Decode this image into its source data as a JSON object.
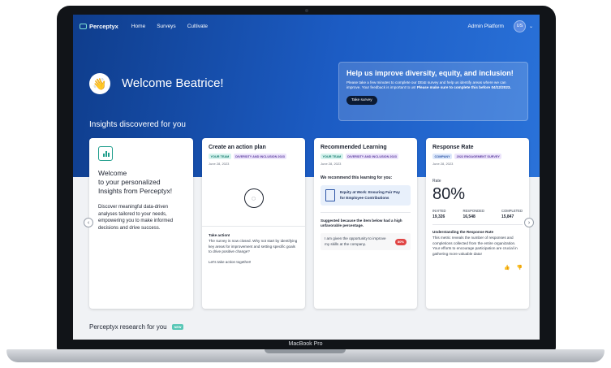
{
  "device": {
    "label": "MacBook Pro"
  },
  "nav": {
    "logo": "Perceptyx",
    "links": [
      "Home",
      "Surveys",
      "Cultivate"
    ],
    "admin": "Admin Platform",
    "user_initials": "US"
  },
  "hero": {
    "welcome": "Welcome Beatrice!",
    "insights_title": "Insights discovered for you"
  },
  "dei": {
    "title": "Help us improve diversity, equity, and inclusion!",
    "body": "Please take a few minutes to complete our DE&I survey and help us identify areas where we can improve. Your feedback is important to us!",
    "body_bold": "Please make sure to complete this before 04/12/2023.",
    "button": "Take survey"
  },
  "card_welcome": {
    "heading": "Welcome\nto your personalized\nInsights from Perceptyx!",
    "text": "Discover meaningful data-driven analyses tailored to your needs, empowering you to make informed decisions and drive success."
  },
  "card_action": {
    "title": "Create an action plan",
    "tags": [
      "YOUR TEAM",
      "DIVERSITY AND INCLUSION 2023"
    ],
    "date": "June 28, 2023",
    "heading": "Take action!",
    "text": "The survey is now closed. Why not start by identifying key areas for improvement and setting specific goals to drive positive change?",
    "cta": "Let's take action together!"
  },
  "card_learning": {
    "title": "Recommended Learning",
    "tags": [
      "YOUR TEAM",
      "DIVERSITY AND INCLUSION 2023"
    ],
    "date": "June 28, 2023",
    "heading": "We recommend this learning for you:",
    "course": "Equity at Work: Ensuring Fair Pay for Employee Contributions",
    "suggested": "Suggested because the item below had a high unfavorable percentage.",
    "item_text": "I am given the opportunity to improve my skills at the company.",
    "item_pct": "80%"
  },
  "card_rate": {
    "title": "Response Rate",
    "tags": [
      "COMPANY",
      "2022 ENGAGEMENT SURVEY"
    ],
    "date": "June 28, 2023",
    "rate_label": "Rate",
    "rate_value": "80%",
    "stats": [
      {
        "label": "INVITED",
        "value": "19,326"
      },
      {
        "label": "RESPONDED",
        "value": "16,548"
      },
      {
        "label": "COMPLETED",
        "value": "15,847"
      }
    ],
    "heading": "Understanding the Response Rate",
    "text": "This metric reveals the number of responses and completions collected from the entire organization. Your efforts to encourage participation are crucial in gathering more valuable data!"
  },
  "research": {
    "title": "Perceptyx research for you",
    "badge": "NEW"
  }
}
